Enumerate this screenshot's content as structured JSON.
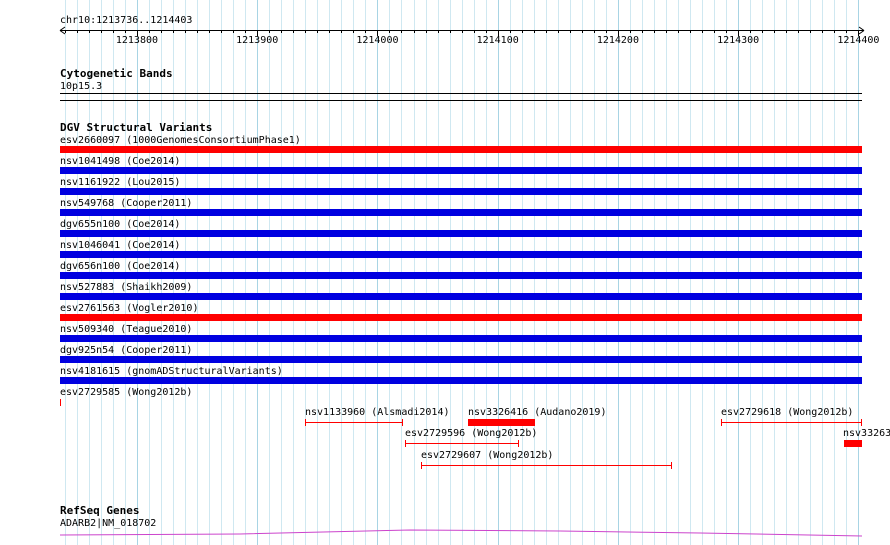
{
  "ruler": {
    "location": "chr10:1213736..1214403",
    "start": 1213736,
    "end": 1214403,
    "ticks": [
      "1213800",
      "1213900",
      "1214000",
      "1214100",
      "1214200",
      "1214300",
      "1214400"
    ]
  },
  "cytoband": {
    "title": "Cytogenetic Bands",
    "band": "10p15.3"
  },
  "dgv": {
    "title": "DGV Structural Variants",
    "colors": {
      "red": "#ff0000",
      "blue": "#0000e0"
    },
    "full_tracks": [
      {
        "label": "esv2660097 (1000GenomesConsortiumPhase1)",
        "color": "red"
      },
      {
        "label": "nsv1041498 (Coe2014)",
        "color": "blue"
      },
      {
        "label": "nsv1161922 (Lou2015)",
        "color": "blue"
      },
      {
        "label": "nsv549768 (Cooper2011)",
        "color": "blue"
      },
      {
        "label": "dgv655n100 (Coe2014)",
        "color": "blue"
      },
      {
        "label": "nsv1046041 (Coe2014)",
        "color": "blue"
      },
      {
        "label": "dgv656n100 (Coe2014)",
        "color": "blue"
      },
      {
        "label": "nsv527883 (Shaikh2009)",
        "color": "blue"
      },
      {
        "label": "esv2761563 (Vogler2010)",
        "color": "red"
      },
      {
        "label": "nsv509340 (Teague2010)",
        "color": "blue"
      },
      {
        "label": "dgv925n54 (Cooper2011)",
        "color": "blue"
      },
      {
        "label": "nsv4181615 (gnomADStructuralVariants)",
        "color": "blue"
      }
    ],
    "partial": [
      {
        "label": "esv2729585 (Wong2012b)",
        "start": 1213736,
        "end": 1213737,
        "style": "thin",
        "row": 0
      },
      {
        "label": "nsv1133960 (Alsmadi2014)",
        "start": 1213940,
        "end": 1214021,
        "style": "thin",
        "row": 1
      },
      {
        "label": "nsv3326416 (Audano2019)",
        "start": 1214075,
        "end": 1214131,
        "style": "thick",
        "row": 1
      },
      {
        "label": "esv2729618 (Wong2012b)",
        "start": 1214286,
        "end": 1214403,
        "style": "thin",
        "row": 1
      },
      {
        "label": "nsv33263",
        "start": 1214388,
        "end": 1214403,
        "style": "thick",
        "row": 2
      },
      {
        "label": "esv2729596 (Wong2012b)",
        "start": 1214023,
        "end": 1214118,
        "style": "thin",
        "row": 2
      },
      {
        "label": "esv2729607 (Wong2012b)",
        "start": 1214036,
        "end": 1214245,
        "style": "thin",
        "row": 3
      }
    ]
  },
  "refseq": {
    "title": "RefSeq Genes",
    "gene": "ADARB2|NM_018702",
    "color": "#cc44cc"
  }
}
